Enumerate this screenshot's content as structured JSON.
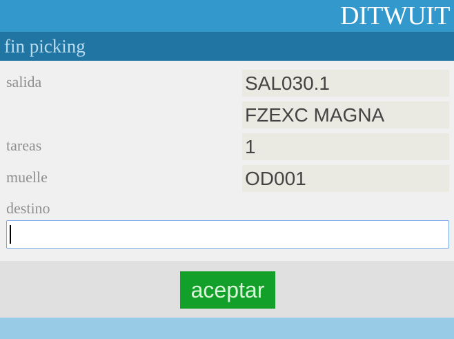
{
  "header": {
    "brand": "DITWUIT"
  },
  "page": {
    "title": "fin picking"
  },
  "fields": {
    "salida": {
      "label": "salida",
      "value1": "SAL030.1",
      "value2": "FZEXC MAGNA"
    },
    "tareas": {
      "label": "tareas",
      "value": "1"
    },
    "muelle": {
      "label": "muelle",
      "value": "OD001"
    },
    "destino": {
      "label": "destino",
      "value": ""
    }
  },
  "actions": {
    "accept_label": "aceptar"
  },
  "colors": {
    "topbar": "#3399cc",
    "titlebar": "#2175a3",
    "button": "#12a02a",
    "footer": "#97cbe6"
  }
}
